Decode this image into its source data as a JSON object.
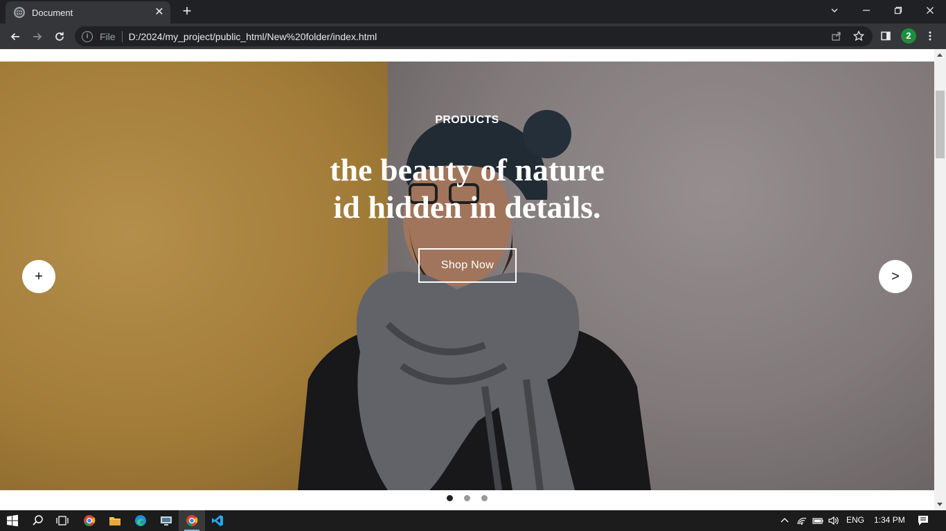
{
  "browser": {
    "tab_title": "Document",
    "address_scheme": "File",
    "address_url": "D:/2024/my_project/public_html/New%20folder/index.html",
    "profile_initial": "2"
  },
  "hero": {
    "overline": "PRODUCTS",
    "headline_line1": "the beauty of nature",
    "headline_line2": "id hidden in details.",
    "cta_label": "Shop Now",
    "prev_label": "+",
    "next_label": ">"
  },
  "carousel": {
    "slide_count": 3,
    "active_index": 0
  },
  "taskbar": {
    "language": "ENG",
    "time": "1:34 PM"
  },
  "colors": {
    "chrome_dark": "#202124",
    "chrome_toolbar": "#35363a",
    "taskbar": "#1c1c1c"
  }
}
